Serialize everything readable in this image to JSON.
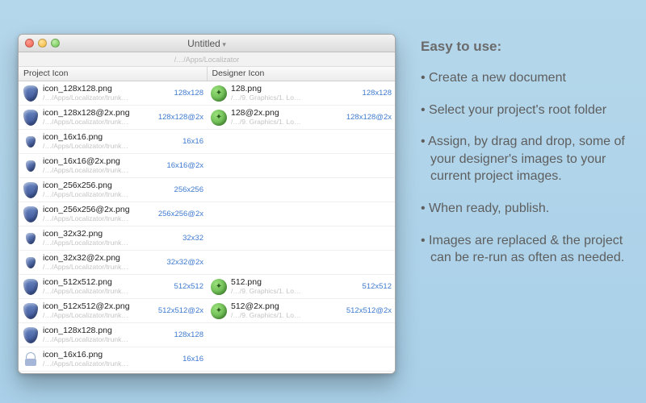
{
  "window": {
    "title": "Untitled",
    "breadcrumb": "/…/Apps/Localizator",
    "columns": {
      "left": "Project Icon",
      "right": "Designer Icon"
    }
  },
  "project_path_fragment": "/…/Apps/Localizator/trunk…",
  "designer_path_fragment": "/…/9. Graphics/1. Lo…",
  "rows": [
    {
      "project": {
        "icon": "blob",
        "name": "icon_128x128.png",
        "dim": "128x128"
      },
      "designer": {
        "icon": "disc",
        "name": "128.png",
        "dim": "128x128"
      }
    },
    {
      "project": {
        "icon": "blob",
        "name": "icon_128x128@2x.png",
        "dim": "128x128@2x"
      },
      "designer": {
        "icon": "disc",
        "name": "128@2x.png",
        "dim": "128x128@2x"
      }
    },
    {
      "project": {
        "icon": "blob-small",
        "name": "icon_16x16.png",
        "dim": "16x16"
      },
      "designer": null
    },
    {
      "project": {
        "icon": "blob-small",
        "name": "icon_16x16@2x.png",
        "dim": "16x16@2x"
      },
      "designer": null
    },
    {
      "project": {
        "icon": "blob",
        "name": "icon_256x256.png",
        "dim": "256x256"
      },
      "designer": null
    },
    {
      "project": {
        "icon": "blob",
        "name": "icon_256x256@2x.png",
        "dim": "256x256@2x"
      },
      "designer": null
    },
    {
      "project": {
        "icon": "blob-small",
        "name": "icon_32x32.png",
        "dim": "32x32"
      },
      "designer": null
    },
    {
      "project": {
        "icon": "blob-small",
        "name": "icon_32x32@2x.png",
        "dim": "32x32@2x"
      },
      "designer": null
    },
    {
      "project": {
        "icon": "blob",
        "name": "icon_512x512.png",
        "dim": "512x512"
      },
      "designer": {
        "icon": "disc",
        "name": "512.png",
        "dim": "512x512"
      }
    },
    {
      "project": {
        "icon": "blob",
        "name": "icon_512x512@2x.png",
        "dim": "512x512@2x"
      },
      "designer": {
        "icon": "disc",
        "name": "512@2x.png",
        "dim": "512x512@2x"
      }
    },
    {
      "project": {
        "icon": "blob",
        "name": "icon_128x128.png",
        "dim": "128x128"
      },
      "designer": null
    },
    {
      "project": {
        "icon": "lock",
        "name": "icon_16x16.png",
        "dim": "16x16"
      },
      "designer": null
    }
  ],
  "promo": {
    "heading": "Easy to use:",
    "bullets": [
      "Create a new document",
      "Select your project's root folder",
      "Assign, by drag and drop, some of your designer's images to your current project images.",
      "When ready, publish.",
      "Images are replaced & the project can be re-run as often as needed."
    ]
  }
}
